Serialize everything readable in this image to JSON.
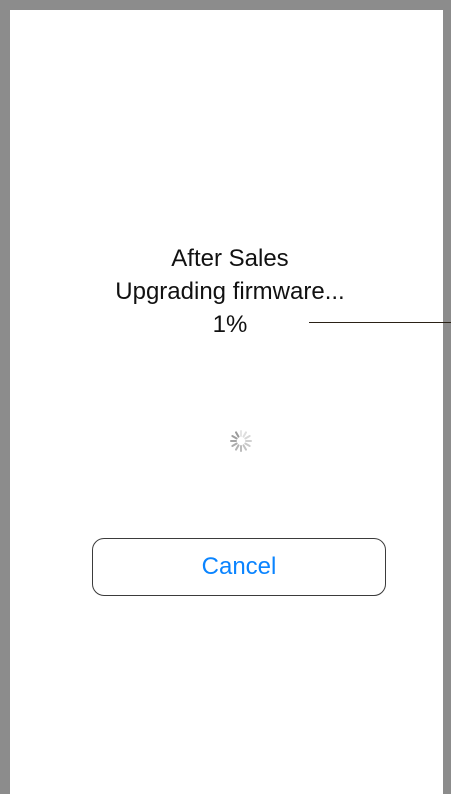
{
  "dialog": {
    "title": "After Sales",
    "message": "Upgrading firmware...",
    "progress_text": "1%",
    "progress_value": 0.01,
    "spinner_icon": "spinner-icon",
    "cancel_label": "Cancel"
  },
  "colors": {
    "text": "#111111",
    "accent": "#0a84ff",
    "frame": "#8c8c8c",
    "callout_line": "#2a2116"
  }
}
